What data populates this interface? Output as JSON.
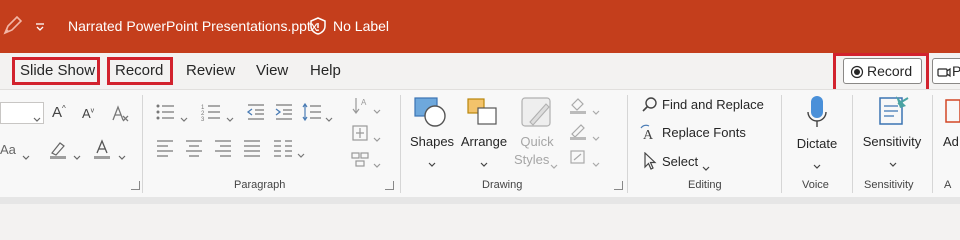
{
  "titlebar": {
    "filename": "Narrated PowerPoint Presentations.pptx",
    "label_status": "No Label",
    "bg_color": "#c43e1c"
  },
  "tabs": [
    "Slide Show",
    "Record",
    "Review",
    "View",
    "Help"
  ],
  "record_button": {
    "label": "Record"
  },
  "partial_button": {
    "label": "P"
  },
  "ribbon": {
    "paragraph_label": "Paragraph",
    "drawing": {
      "label": "Drawing",
      "shapes": "Shapes",
      "arrange": "Arrange",
      "quick": "Quick",
      "styles": "Styles"
    },
    "editing": {
      "label": "Editing",
      "find_replace": "Find and Replace",
      "replace_fonts": "Replace Fonts",
      "select": "Select"
    },
    "voice": {
      "label": "Voice",
      "dictate": "Dictate"
    },
    "sensitivity": {
      "label": "Sensitivity",
      "button": "Sensitivity"
    },
    "partial_group": {
      "button": "Ad",
      "label": "A"
    },
    "font_partial": "Aa",
    "icon_names": [
      "pen-icon",
      "dropdown-arrow-icon",
      "shield-icon",
      "record-dot-icon",
      "microphone-icon",
      "sensitivity-icon",
      "search-icon",
      "replace-fonts-icon",
      "select-cursor-icon",
      "shapes-icon",
      "arrange-icon",
      "quick-styles-icon",
      "fill-icon",
      "outline-icon",
      "effects-icon"
    ]
  }
}
